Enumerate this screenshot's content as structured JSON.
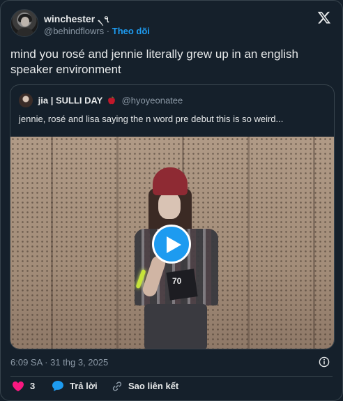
{
  "author": {
    "display_name": "winchester ৲৭",
    "handle": "@behindflowrs",
    "separator": " · ",
    "follow_label": "Theo dõi"
  },
  "tweet": {
    "text": "mind you rosé and jennie literally grew up in an english speaker environment"
  },
  "quote": {
    "name": "jia | SULLI DAY",
    "handle": "@hyoyeonatee",
    "text": "jennie, rosé and lisa saying the n word pre debut this is so weird...",
    "video": {
      "jersey_number": "70"
    }
  },
  "meta": {
    "timestamp": "6:09 SA · 31 thg 3, 2025"
  },
  "actions": {
    "like_count": "3",
    "reply_label": "Trả lời",
    "copy_link_label": "Sao liên kết"
  },
  "colors": {
    "background": "#15202b",
    "accent": "#1d9bf0",
    "like": "#f91880",
    "muted_text": "#8b98a5",
    "border": "#38444d"
  },
  "icons": [
    "x-logo-icon",
    "play-icon",
    "info-icon",
    "heart-icon",
    "reply-bubble-icon",
    "link-icon",
    "apple-emoji-icon"
  ]
}
